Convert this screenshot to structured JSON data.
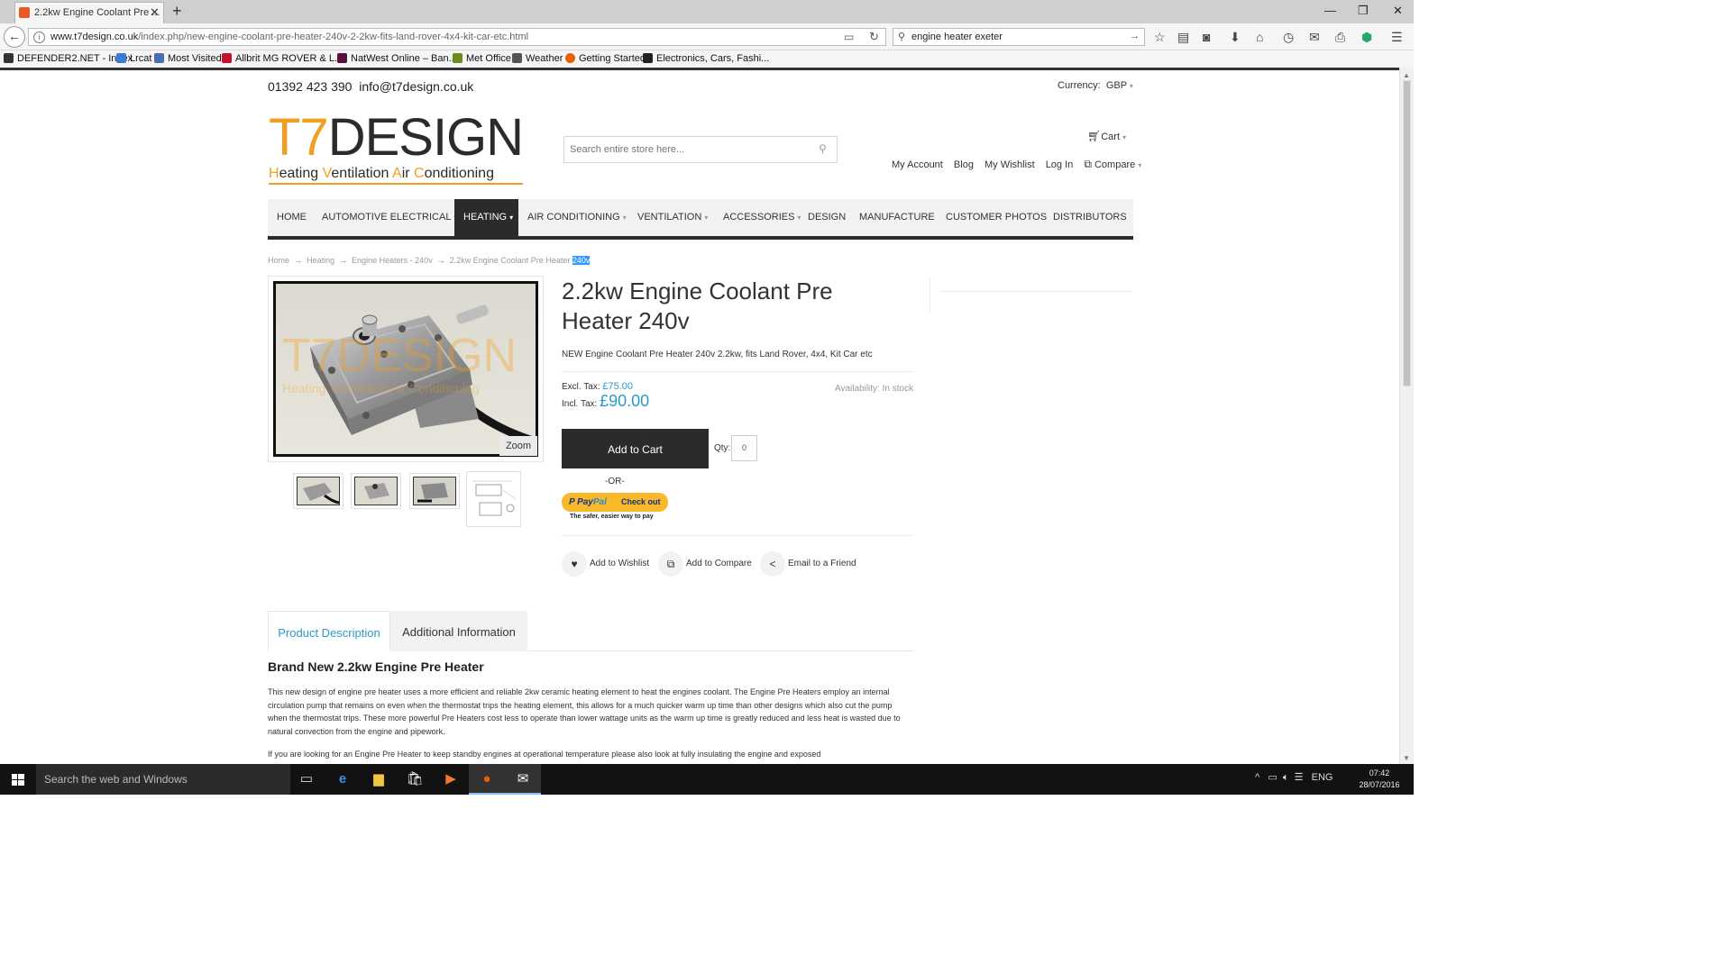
{
  "browser": {
    "tab_title": "2.2kw Engine Coolant Pre ...",
    "url_base": "www.t7design.co.uk",
    "url_path": "/index.php/new-engine-coolant-pre-heater-240v-2-2kw-fits-land-rover-4x4-kit-car-etc.html",
    "search_query": "engine heater exeter",
    "bookmarks": [
      "DEFENDER2.NET - Index",
      "Lrcat",
      "Most Visited",
      "Allbrit MG ROVER & L...",
      "NatWest Online – Ban...",
      "Met Office",
      "Weather",
      "Getting Started",
      "Electronics, Cars, Fashi..."
    ]
  },
  "header": {
    "phone": "01392 423 390",
    "email": "info@t7design.co.uk",
    "currency_label": "Currency:",
    "currency_value": "GBP",
    "logo_main_t7": "T7",
    "logo_main_rest": "DESIGN",
    "logo_sub": {
      "h": "H",
      "eating": "eating ",
      "v": "V",
      "entilation": "entilation ",
      "a": "A",
      "ir": "ir ",
      "c": "C",
      "onditioning": "onditioning"
    },
    "search_placeholder": "Search entire store here...",
    "cart_label": "Cart",
    "links": {
      "account": "My Account",
      "blog": "Blog",
      "wishlist": "My Wishlist",
      "login": "Log In",
      "compare": "Compare"
    }
  },
  "nav": [
    {
      "label": "Home"
    },
    {
      "label": "Automotive Electrical"
    },
    {
      "label": "Heating"
    },
    {
      "label": "Air Conditioning"
    },
    {
      "label": "Ventilation"
    },
    {
      "label": "Accessories"
    },
    {
      "label": "Design"
    },
    {
      "label": "Manufacture"
    },
    {
      "label": "Customer Photos"
    },
    {
      "label": "Distributors"
    }
  ],
  "breadcrumb": {
    "home": "Home",
    "heating": "Heating",
    "engine_heaters": "Engine Heaters - 240v",
    "current": "2.2kw Engine Coolant Pre Heater",
    "current_selected": "240v"
  },
  "product": {
    "title": "2.2kw Engine Coolant Pre Heater 240v",
    "short_description": "NEW Engine Coolant Pre Heater 240v 2.2kw, fits Land Rover, 4x4, Kit Car etc",
    "excl_tax_label": "Excl. Tax:",
    "excl_tax_price": "£75.00",
    "incl_tax_label": "Incl. Tax:",
    "incl_tax_price": "£90.00",
    "availability": "Availability: In stock",
    "add_to_cart": "Add to Cart",
    "qty_label": "Qty:",
    "qty_value": "0",
    "or_label": "-OR-",
    "paypal_brand_1": "Pay",
    "paypal_brand_2": "Pal",
    "paypal_checkout": "Check out",
    "paypal_tagline": "The safer, easier way to pay",
    "zoom": "Zoom",
    "watermark_main": "T7DESIGN",
    "watermark_sub": "Heating Ventilation Air Conditioning",
    "actions": {
      "wishlist": "Add to Wishlist",
      "compare": "Add to Compare",
      "email": "Email to a Friend"
    }
  },
  "tabs": {
    "description": "Product Description",
    "additional": "Additional Information"
  },
  "description": {
    "heading": "Brand New 2.2kw Engine Pre Heater",
    "para1": "This new design of engine pre heater uses a more efficient and reliable 2kw ceramic heating element to heat the engines coolant. The Engine Pre Heaters employ an internal circulation pump that remains on even when the thermostat trips the heating element, this allows for a much quicker warm up time than other designs which also cut the pump when the thermostat trips. These more powerful Pre Heaters cost less to operate than lower wattage units as the warm up time is greatly reduced and less heat is wasted due to natural convection from the engine and pipework.",
    "para2": "If you are looking for an Engine Pre Heater to keep standby engines at operational temperature please also look at fully insulating the engine and exposed"
  },
  "taskbar": {
    "search_placeholder": "Search the web and Windows",
    "lang": "ENG",
    "time": "07:42",
    "date": "28/07/2016"
  },
  "colors": {
    "accent": "#2c9ac9",
    "brand_orange": "#f0a020",
    "dark": "#2b2b2b"
  }
}
